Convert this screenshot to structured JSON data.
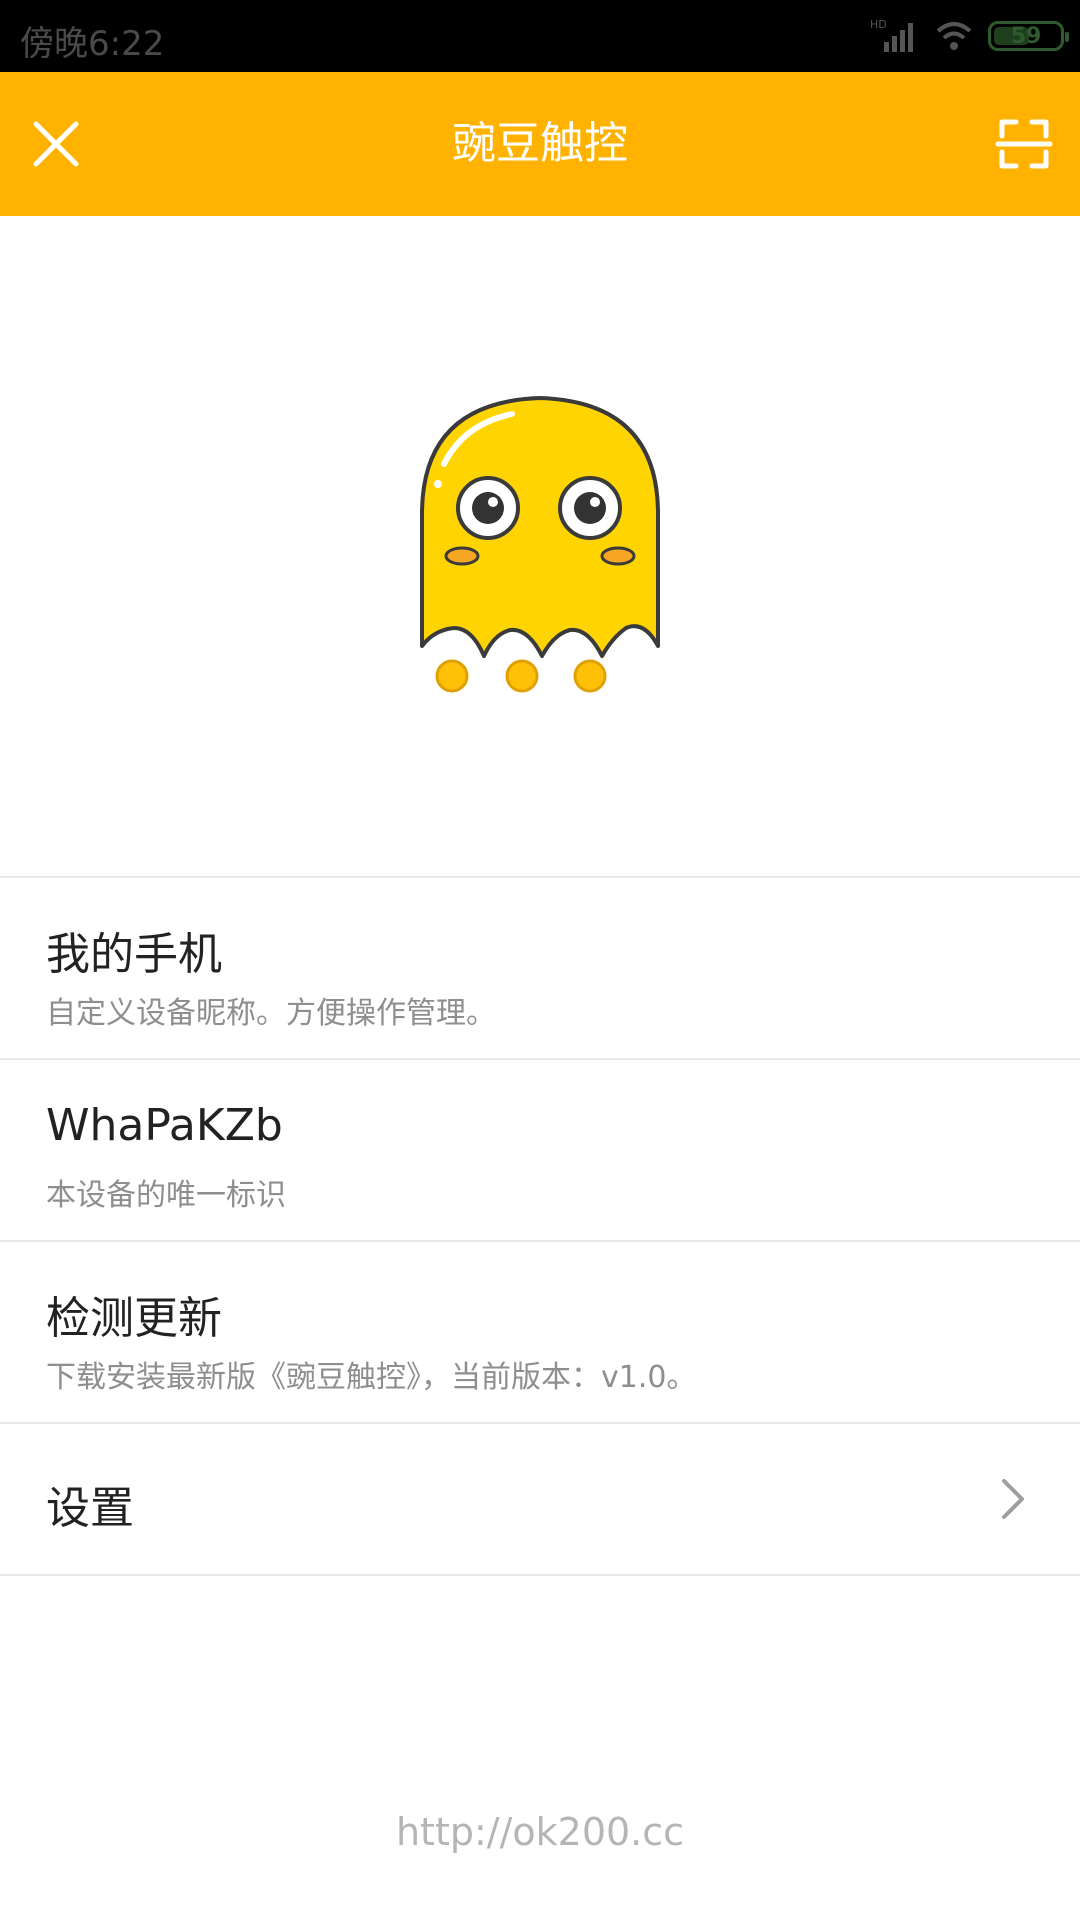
{
  "status_bar": {
    "time": "傍晚6:22",
    "network_label": "HD",
    "battery_percent": "59"
  },
  "app_bar": {
    "title": "豌豆触控",
    "accent_color": "#FFB300",
    "close_icon": "close-icon",
    "scan_icon": "scan-icon"
  },
  "mascot": {
    "icon": "yellow-ghost-mascot"
  },
  "menu": {
    "items": [
      {
        "title": "我的手机",
        "subtitle": "自定义设备昵称。方便操作管理。"
      },
      {
        "title": "WhaPaKZb",
        "subtitle": "本设备的唯一标识"
      },
      {
        "title": "检测更新",
        "subtitle": "下载安装最新版《豌豆触控》，当前版本：v1.0。"
      },
      {
        "title": "设置",
        "icon": "chevron-right-icon"
      }
    ]
  },
  "footer": {
    "link": "http://ok200.cc"
  }
}
